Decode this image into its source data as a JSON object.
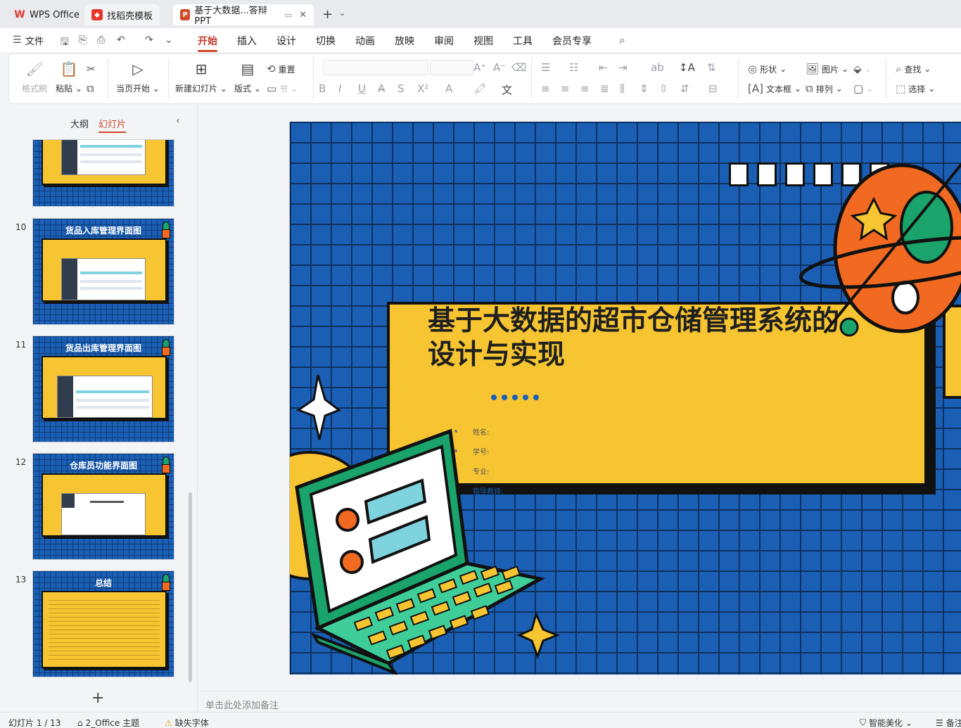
{
  "tabs": [
    {
      "label": "WPS Office",
      "color": "#e6352b"
    },
    {
      "label": "找稻壳模板",
      "color": "#e6352b"
    },
    {
      "label": "基于大数据...答辩PPT",
      "color": "#d04a2b"
    }
  ],
  "menu": {
    "file": "文件",
    "items": [
      "开始",
      "插入",
      "设计",
      "切换",
      "动画",
      "放映",
      "审阅",
      "视图",
      "工具",
      "会员专享"
    ],
    "active": "开始"
  },
  "ribbon": {
    "format_painter": "格式刷",
    "paste": "粘贴",
    "from_current": "当页开始",
    "new_slide": "新建幻灯片",
    "layout": "版式",
    "reset": "重置",
    "section": "节",
    "shape": "形状",
    "picture": "图片",
    "textbox": "文本框",
    "arrange": "排列",
    "find": "查找",
    "select": "选择"
  },
  "left_panel": {
    "tab_outline": "大纲",
    "tab_slides": "幻灯片",
    "slides": [
      {
        "num": "10",
        "title": "货品入库管理界面图"
      },
      {
        "num": "11",
        "title": "货品出库管理界面图"
      },
      {
        "num": "12",
        "title": "仓库员功能界面图"
      },
      {
        "num": "13",
        "title": "总结"
      }
    ]
  },
  "slide": {
    "title": "基于大数据的超市仓储管理系统的设计与实现",
    "title_line1": "基于大数据的超市仓储管理系统的",
    "title_line2": "设计与实现",
    "info": [
      "姓名:",
      "学号:",
      "专业:",
      "指导教师:"
    ]
  },
  "notes_placeholder": "单击此处添加备注",
  "status": {
    "slide_counter": "幻灯片 1 / 13",
    "theme": "2_Office 主题",
    "missing_font": "缺失字体",
    "smart_beautify": "智能美化",
    "notes": "备注"
  },
  "colors": {
    "accent": "#d04a2b",
    "slide_blue": "#1b5fb5",
    "slide_yellow": "#f7c531",
    "planet_orange": "#f26a21",
    "planet_green": "#1aa36a",
    "laptop_green": "#1aa36a"
  }
}
